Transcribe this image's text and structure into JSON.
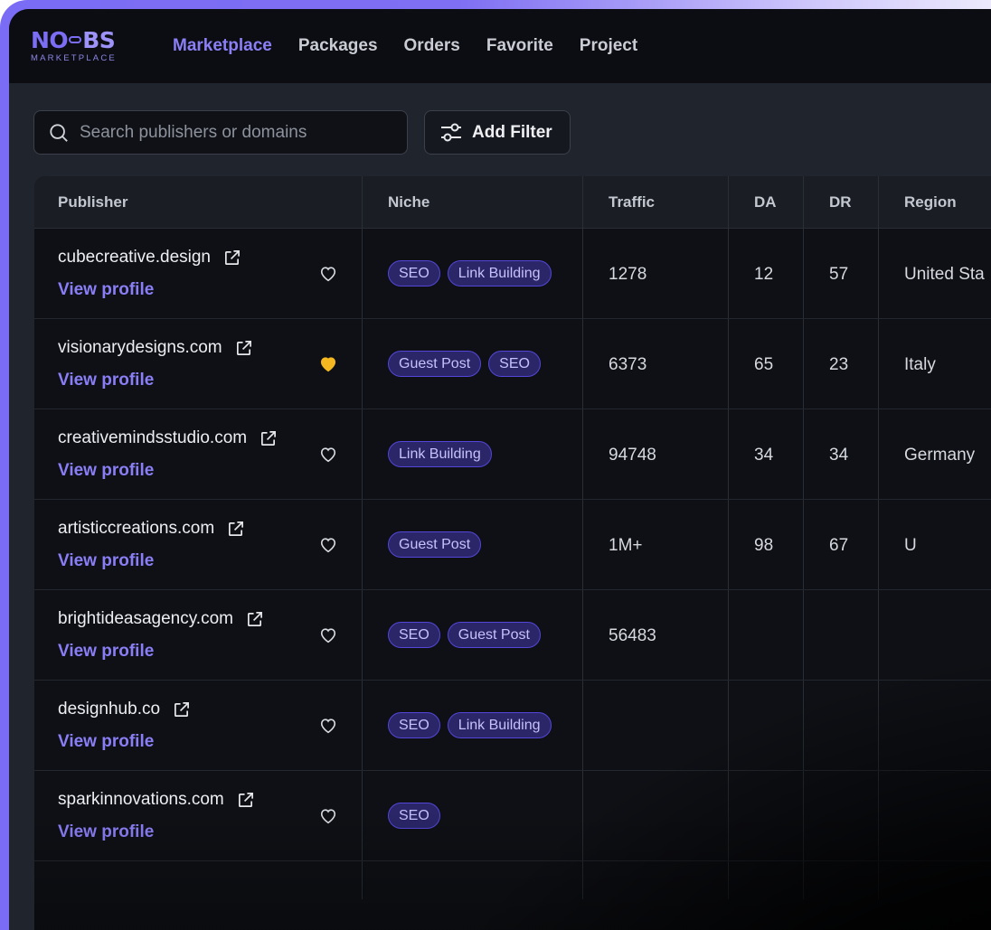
{
  "brand": {
    "name_left": "NO",
    "name_right": "BS",
    "subtitle": "MARKETPLACE"
  },
  "nav": {
    "items": [
      {
        "label": "Marketplace",
        "active": true
      },
      {
        "label": "Packages",
        "active": false
      },
      {
        "label": "Orders",
        "active": false
      },
      {
        "label": "Favorite",
        "active": false
      },
      {
        "label": "Project",
        "active": false
      }
    ]
  },
  "search": {
    "placeholder": "Search publishers or domains",
    "value": ""
  },
  "filter": {
    "label": "Add Filter"
  },
  "table": {
    "headers": {
      "publisher": "Publisher",
      "niche": "Niche",
      "traffic": "Traffic",
      "da": "DA",
      "dr": "DR",
      "region": "Region"
    },
    "rows": [
      {
        "domain": "cubecreative.design",
        "link": "View profile",
        "favorite": false,
        "niches": [
          "SEO",
          "Link Building"
        ],
        "traffic": "1278",
        "da": "12",
        "dr": "57",
        "region": "United Sta"
      },
      {
        "domain": "visionarydesigns.com",
        "link": "View profile",
        "favorite": true,
        "niches": [
          "Guest Post",
          "SEO"
        ],
        "traffic": "6373",
        "da": "65",
        "dr": "23",
        "region": "Italy"
      },
      {
        "domain": "creativemindsstudio.com",
        "link": "View profile",
        "favorite": false,
        "niches": [
          "Link Building"
        ],
        "traffic": "94748",
        "da": "34",
        "dr": "34",
        "region": "Germany"
      },
      {
        "domain": "artisticcreations.com",
        "link": "View profile",
        "favorite": false,
        "niches": [
          "Guest Post"
        ],
        "traffic": "1M+",
        "da": "98",
        "dr": "67",
        "region": "U"
      },
      {
        "domain": "brightideasagency.com",
        "link": "View profile",
        "favorite": false,
        "niches": [
          "SEO",
          "Guest Post"
        ],
        "traffic": "56483",
        "da": "",
        "dr": "",
        "region": ""
      },
      {
        "domain": "designhub.co",
        "link": "View profile",
        "favorite": false,
        "niches": [
          "SEO",
          "Link Building"
        ],
        "traffic": "",
        "da": "",
        "dr": "",
        "region": ""
      },
      {
        "domain": "sparkinnovations.com",
        "link": "View profile",
        "favorite": false,
        "niches": [
          "SEO"
        ],
        "traffic": "",
        "da": "",
        "dr": "",
        "region": ""
      }
    ]
  },
  "colors": {
    "accent": "#8a7ef6",
    "favorite": "#f5b820",
    "background": "#0e1015",
    "frame": "#7a6cf5"
  }
}
